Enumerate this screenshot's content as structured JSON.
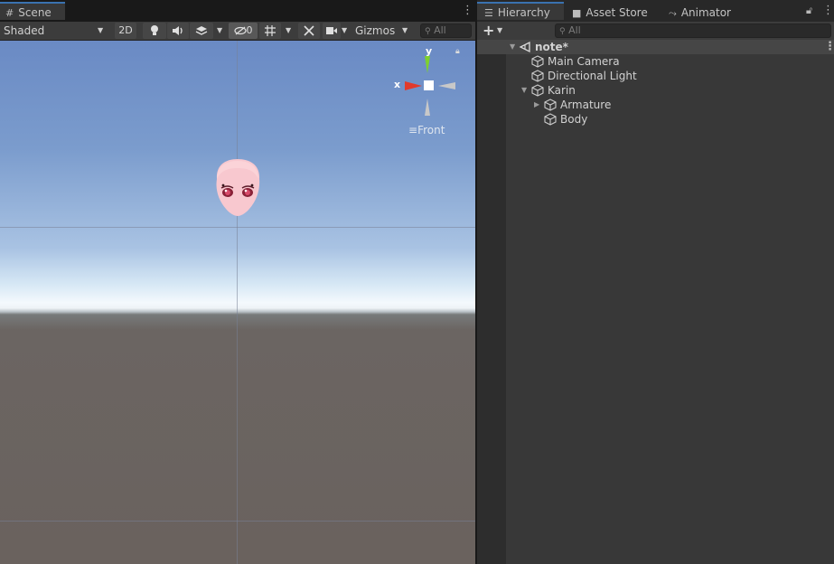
{
  "scene_panel": {
    "tab_label": "Scene",
    "tab_icon": "hash-grid-icon",
    "toolbar": {
      "shading_mode": "Shaded",
      "mode_2d_label": "2D",
      "hidden_count": "0",
      "gizmos_label": "Gizmos",
      "search_placeholder": "All"
    },
    "gizmo": {
      "y_label": "y",
      "x_label": "x",
      "view_label": "Front"
    }
  },
  "hierarchy_panel": {
    "tabs": [
      {
        "label": "Hierarchy",
        "icon": "list-icon",
        "active": true
      },
      {
        "label": "Asset Store",
        "icon": "shopping-bag-icon",
        "active": false
      },
      {
        "label": "Animator",
        "icon": "animator-icon",
        "active": false
      }
    ],
    "search_placeholder": "All",
    "tree": [
      {
        "label": "note*",
        "depth": 0,
        "type": "scene",
        "expanded": true
      },
      {
        "label": "Main Camera",
        "depth": 1,
        "type": "gameobject"
      },
      {
        "label": "Directional Light",
        "depth": 1,
        "type": "gameobject"
      },
      {
        "label": "Karin",
        "depth": 1,
        "type": "gameobject",
        "expanded": true
      },
      {
        "label": "Armature",
        "depth": 2,
        "type": "gameobject",
        "expanded": false
      },
      {
        "label": "Body",
        "depth": 2,
        "type": "gameobject"
      }
    ]
  },
  "colors": {
    "accent_tab": "#3a72b0",
    "panel_bg": "#383838",
    "toolbar_bg": "#3c3c3c",
    "gizmo_x": "#e23a2c",
    "gizmo_y": "#7ed02e"
  }
}
